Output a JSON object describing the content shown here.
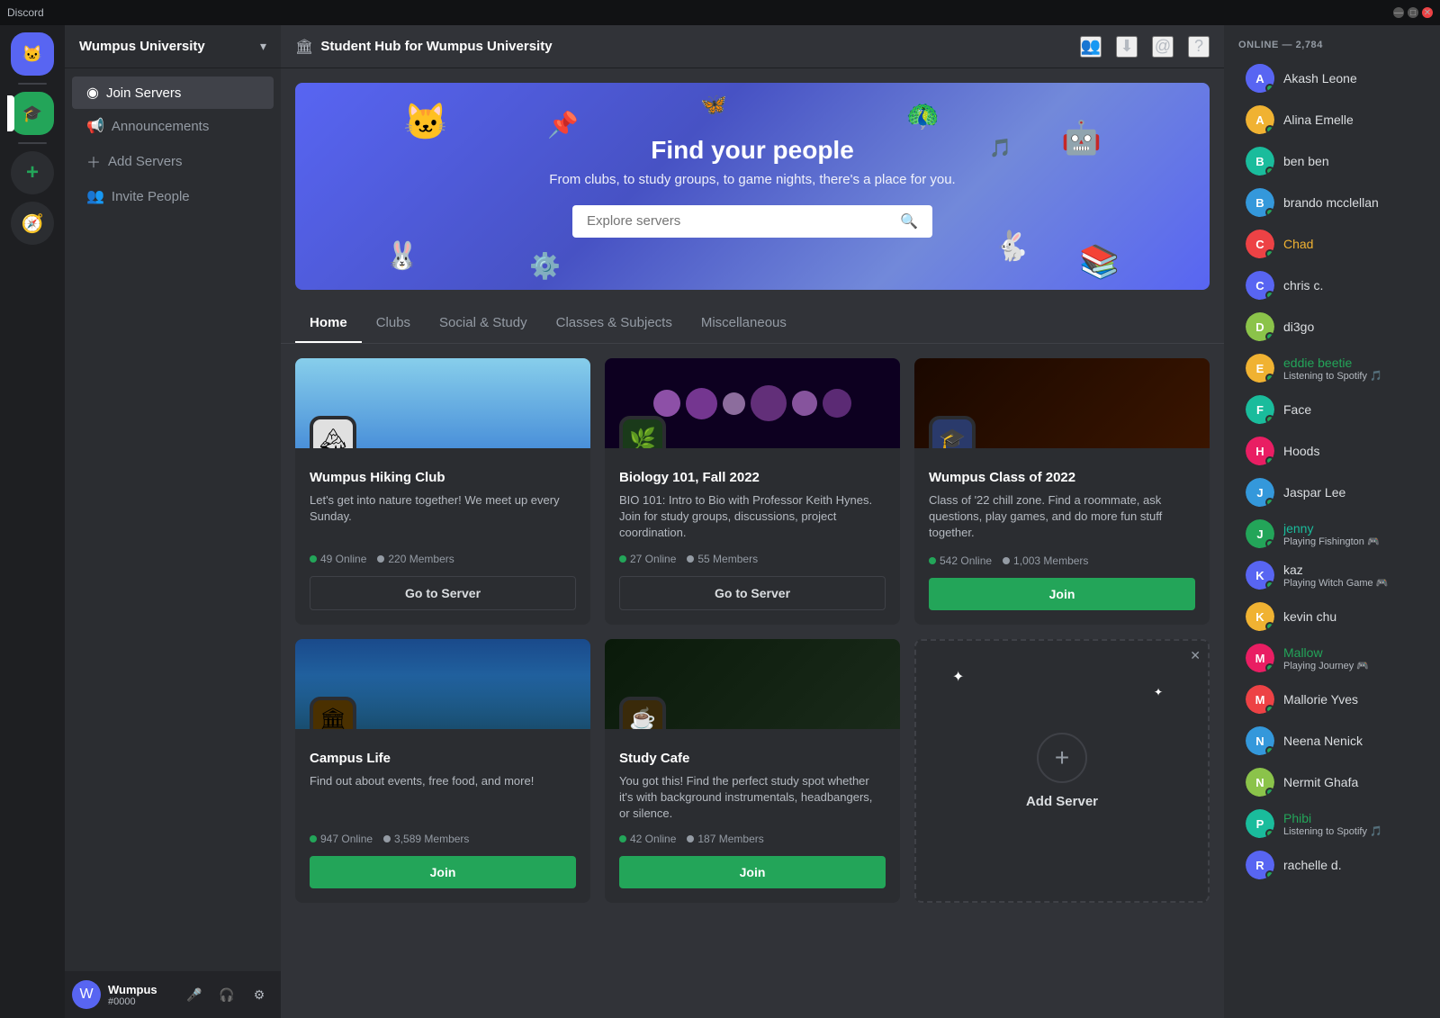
{
  "titlebar": {
    "title": "Discord",
    "minimize": "—",
    "maximize": "□",
    "close": "✕"
  },
  "server_sidebar": {
    "servers": [
      {
        "id": "discord-home",
        "label": "Discord Home",
        "icon_text": "🐱",
        "color": "#5865f2",
        "active": false
      },
      {
        "id": "wumpus-uni",
        "label": "Wumpus University",
        "icon_text": "🎓",
        "color": "#23a559",
        "active": true
      }
    ],
    "add_server_label": "+",
    "discover_label": "🧭"
  },
  "channel_sidebar": {
    "server_name": "Wumpus University",
    "channels": [
      {
        "id": "join-servers",
        "label": "Join Servers",
        "icon": "◉",
        "active": true
      },
      {
        "id": "announcements",
        "label": "Announcements",
        "icon": "📢",
        "active": false
      },
      {
        "id": "add-servers",
        "label": "Add Servers",
        "icon": "+",
        "active": false
      },
      {
        "id": "invite-people",
        "label": "Invite People",
        "icon": "👥",
        "active": false
      }
    ],
    "user": {
      "name": "Wumpus",
      "discriminator": "#0000",
      "avatar_color": "#5865f2"
    }
  },
  "topbar": {
    "icon": "🏛",
    "title": "Student Hub for Wumpus University"
  },
  "hero": {
    "title": "Find your people",
    "subtitle": "From clubs, to study groups, to game nights, there's a place for you.",
    "search_placeholder": "Explore servers"
  },
  "tabs": [
    {
      "id": "home",
      "label": "Home",
      "active": true
    },
    {
      "id": "clubs",
      "label": "Clubs",
      "active": false
    },
    {
      "id": "social-study",
      "label": "Social & Study",
      "active": false
    },
    {
      "id": "classes",
      "label": "Classes & Subjects",
      "active": false
    },
    {
      "id": "misc",
      "label": "Miscellaneous",
      "active": false
    }
  ],
  "server_cards": [
    {
      "id": "hiking-club",
      "name": "Wumpus Hiking Club",
      "description": "Let's get into nature together! We meet up every Sunday.",
      "online": "49 Online",
      "members": "220 Members",
      "button_label": "Go to Server",
      "button_type": "goto",
      "banner_class": "banner-hiking",
      "avatar_icon": "🏔"
    },
    {
      "id": "bio-101",
      "name": "Biology 101, Fall 2022",
      "description": "BIO 101: Intro to Bio with Professor Keith Hynes. Join for study groups, discussions, project coordination.",
      "online": "27 Online",
      "members": "55 Members",
      "button_label": "Go to Server",
      "button_type": "goto",
      "banner_class": "banner-bio",
      "avatar_icon": "🌿"
    },
    {
      "id": "class-2022",
      "name": "Wumpus Class of 2022",
      "description": "Class of '22 chill zone. Find a roommate, ask questions, play games, and do more fun stuff together.",
      "online": "542 Online",
      "members": "1,003 Members",
      "button_label": "Join",
      "button_type": "join",
      "banner_class": "banner-class",
      "avatar_icon": "🎓"
    },
    {
      "id": "campus-life",
      "name": "Campus Life",
      "description": "Find out about events, free food, and more!",
      "online": "947 Online",
      "members": "3,589 Members",
      "button_label": "Join",
      "button_type": "join",
      "banner_class": "banner-campus",
      "avatar_icon": "🏛"
    },
    {
      "id": "study-cafe",
      "name": "Study Cafe",
      "description": "You got this! Find the perfect study spot whether it's with background instrumentals, headbangers, or silence.",
      "online": "42 Online",
      "members": "187 Members",
      "button_label": "Join",
      "button_type": "join",
      "banner_class": "banner-study",
      "avatar_icon": "☕"
    }
  ],
  "add_server": {
    "label": "Add Server"
  },
  "members_sidebar": {
    "header": "ONLINE — 2,784",
    "members": [
      {
        "id": "akash",
        "name": "Akash Leone",
        "color": "color-default",
        "av_color": "av-purple",
        "av_text": "A",
        "status": "status-online",
        "subtext": ""
      },
      {
        "id": "alina",
        "name": "Alina Emelle",
        "color": "color-default",
        "av_color": "av-orange",
        "av_text": "A",
        "status": "status-online",
        "subtext": ""
      },
      {
        "id": "ben",
        "name": "ben ben",
        "color": "color-default",
        "av_color": "av-teal",
        "av_text": "B",
        "status": "status-online",
        "subtext": ""
      },
      {
        "id": "brando",
        "name": "brando mcclellan",
        "color": "color-default",
        "av_color": "av-blue",
        "av_text": "B",
        "status": "status-online",
        "subtext": ""
      },
      {
        "id": "chad",
        "name": "Chad",
        "color": "color-yellow",
        "av_color": "av-red",
        "av_text": "C",
        "status": "status-online",
        "subtext": ""
      },
      {
        "id": "chris",
        "name": "chris c.",
        "color": "color-default",
        "av_color": "av-purple",
        "av_text": "C",
        "status": "status-online",
        "subtext": ""
      },
      {
        "id": "di3go",
        "name": "di3go",
        "color": "color-default",
        "av_color": "av-lime",
        "av_text": "D",
        "status": "status-online",
        "subtext": ""
      },
      {
        "id": "eddie",
        "name": "eddie beetie",
        "color": "color-green",
        "av_color": "av-orange",
        "av_text": "E",
        "status": "status-online",
        "subtext": "Listening to Spotify 🎵"
      },
      {
        "id": "face",
        "name": "Face",
        "color": "color-default",
        "av_color": "av-teal",
        "av_text": "F",
        "status": "status-online",
        "subtext": ""
      },
      {
        "id": "hoods",
        "name": "Hoods",
        "color": "color-default",
        "av_color": "av-pink",
        "av_text": "H",
        "status": "status-online",
        "subtext": ""
      },
      {
        "id": "jaspar",
        "name": "Jaspar Lee",
        "color": "color-default",
        "av_color": "av-blue",
        "av_text": "J",
        "status": "status-online",
        "subtext": ""
      },
      {
        "id": "jenny",
        "name": "jenny",
        "color": "color-teal",
        "av_color": "av-green",
        "av_text": "J",
        "status": "status-online",
        "subtext": "Playing Fishington 🎮"
      },
      {
        "id": "kaz",
        "name": "kaz",
        "color": "color-default",
        "av_color": "av-purple",
        "av_text": "K",
        "status": "status-online",
        "subtext": "Playing Witch Game 🎮"
      },
      {
        "id": "kevin",
        "name": "kevin chu",
        "color": "color-default",
        "av_color": "av-orange",
        "av_text": "K",
        "status": "status-online",
        "subtext": ""
      },
      {
        "id": "mallow",
        "name": "Mallow",
        "color": "color-green",
        "av_color": "av-pink",
        "av_text": "M",
        "status": "status-online",
        "subtext": "Playing Journey 🎮"
      },
      {
        "id": "mallorie",
        "name": "Mallorie Yves",
        "color": "color-default",
        "av_color": "av-red",
        "av_text": "M",
        "status": "status-online",
        "subtext": ""
      },
      {
        "id": "neena",
        "name": "Neena Nenick",
        "color": "color-default",
        "av_color": "av-blue",
        "av_text": "N",
        "status": "status-online",
        "subtext": ""
      },
      {
        "id": "nermit",
        "name": "Nermit Ghafa",
        "color": "color-default",
        "av_color": "av-lime",
        "av_text": "N",
        "status": "status-online",
        "subtext": ""
      },
      {
        "id": "phibi",
        "name": "Phibi",
        "color": "color-green",
        "av_color": "av-teal",
        "av_text": "P",
        "status": "status-online",
        "subtext": "Listening to Spotify 🎵"
      },
      {
        "id": "rachelle",
        "name": "rachelle d.",
        "color": "color-default",
        "av_color": "av-purple",
        "av_text": "R",
        "status": "status-online",
        "subtext": ""
      }
    ]
  }
}
